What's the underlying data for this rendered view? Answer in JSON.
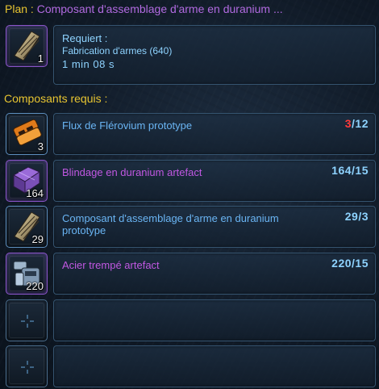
{
  "header": {
    "label": "Plan :",
    "name": "Composant d'assemblage d'arme en duranium ..."
  },
  "schematic": {
    "count": "1",
    "requires_label": "Requiert :",
    "skill": "Fabrication d'armes (640)",
    "time": "1 min 08 s"
  },
  "components_title": "Composants requis :",
  "components": [
    {
      "name": "Flux de Flérovium prototype",
      "name_color": "#6ab5f4",
      "slot_count": "3",
      "have": "3",
      "need": "/12",
      "icon": "orange-flux-icon"
    },
    {
      "name": "Blindage en duranium artefact",
      "name_color": "#c158e2",
      "slot_count": "164",
      "have": "164",
      "need": "/15",
      "icon": "purple-armor-plating-icon"
    },
    {
      "name": "Composant d'assemblage d'arme en duranium prototype",
      "name_color": "#6ab5f4",
      "slot_count": "29",
      "have": "29",
      "need": "/3",
      "icon": "duranium-component-icon"
    },
    {
      "name": "Acier trempé artefact",
      "name_color": "#c158e2",
      "slot_count": "220",
      "have": "220",
      "need": "/15",
      "icon": "tempered-steel-icon"
    }
  ],
  "colors": {
    "gold": "#e8c531",
    "purple": "#b16ae0",
    "blue": "#6ab5f4",
    "insufficient": "#ff3a3a"
  }
}
